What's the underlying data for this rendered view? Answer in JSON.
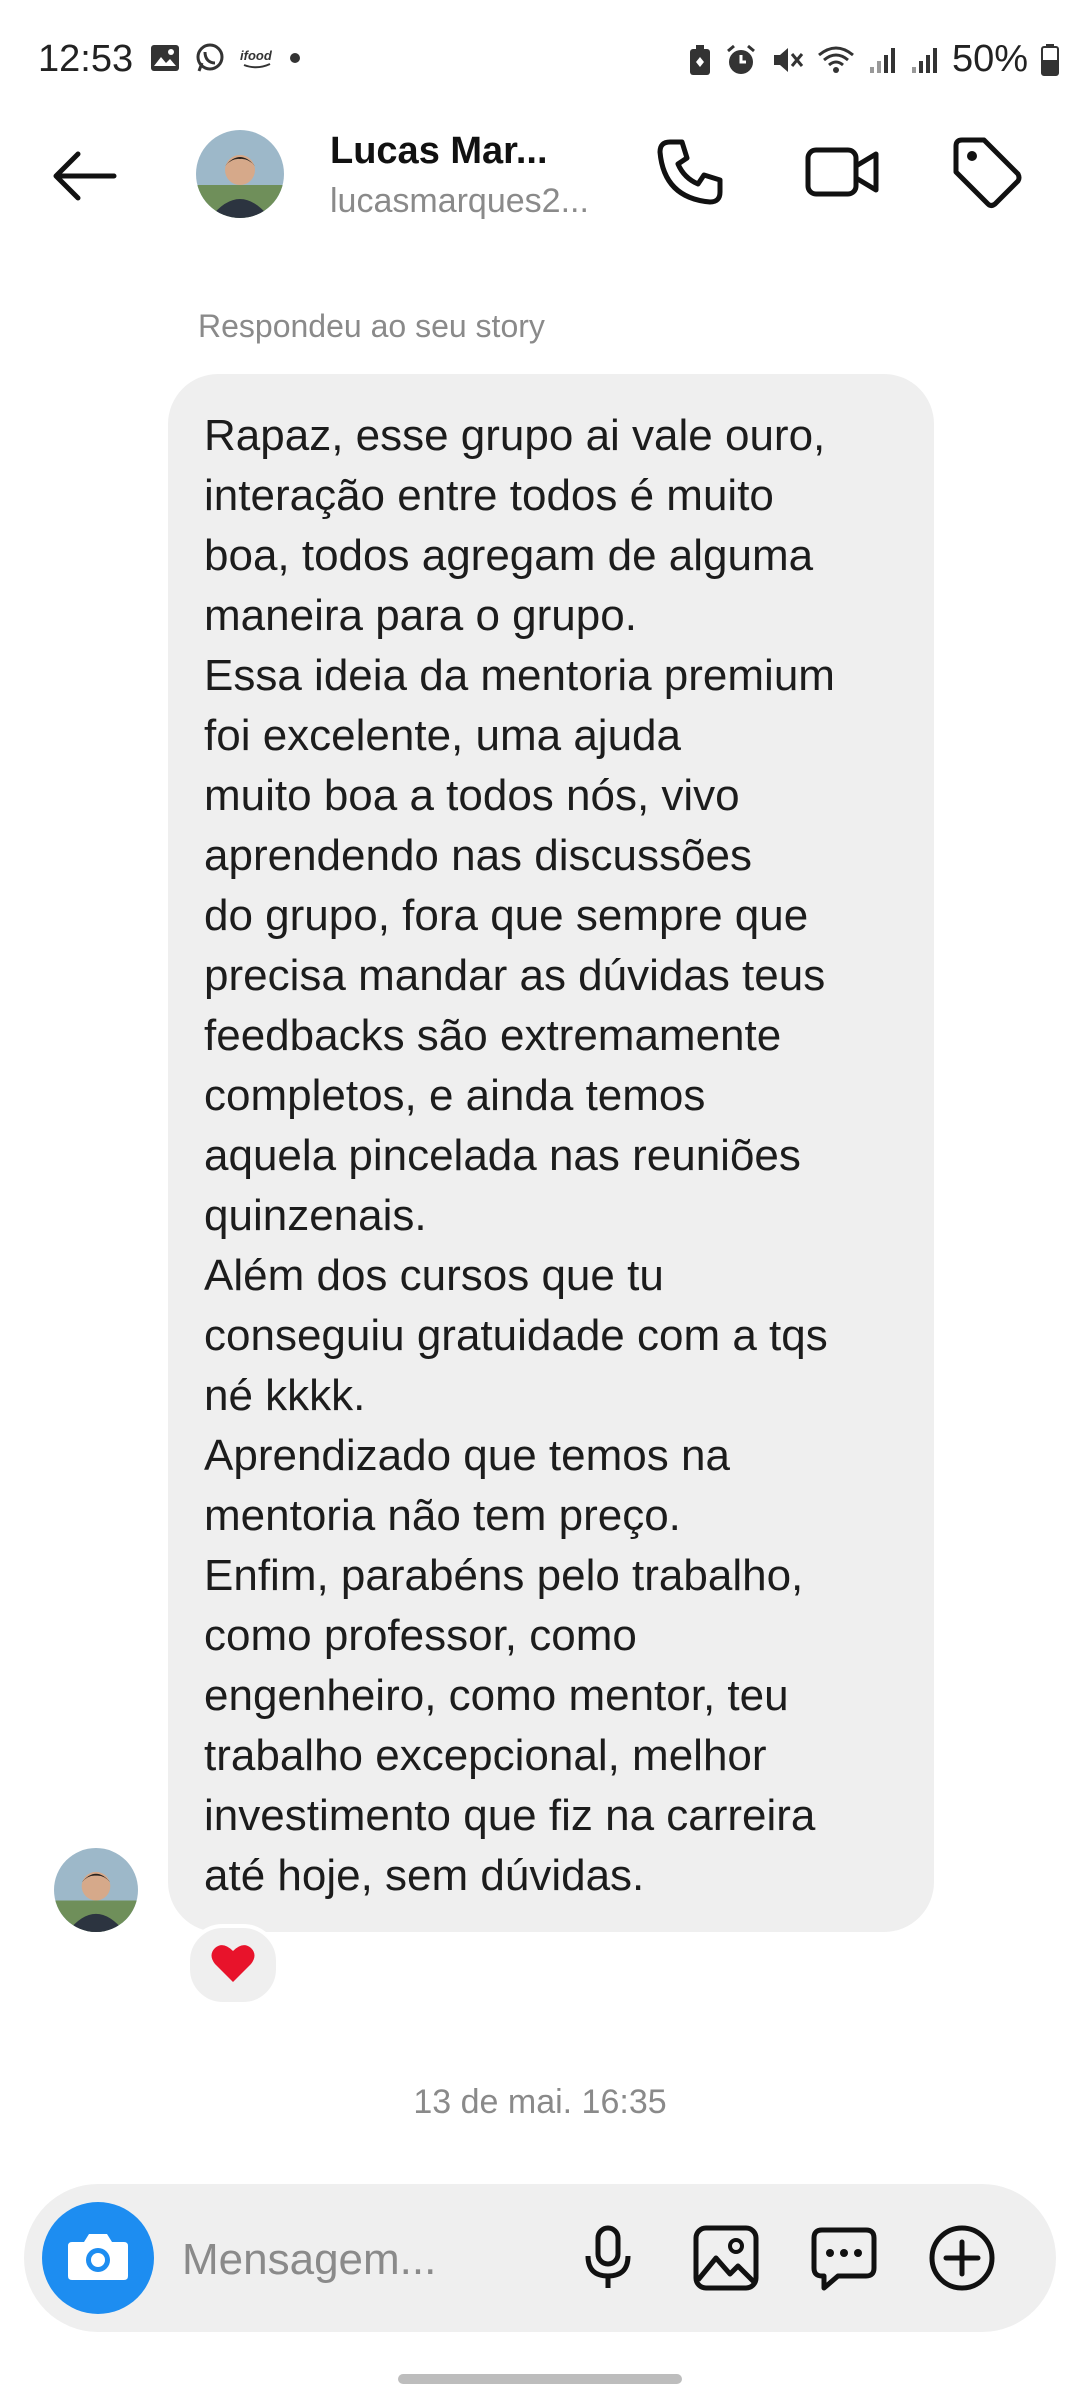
{
  "status_bar": {
    "time": "12:53",
    "battery": "50%",
    "left_icons": [
      "image-icon",
      "whatsapp-icon",
      "ifood-icon",
      "dot-icon"
    ],
    "right_icons": [
      "battery-saver-icon",
      "alarm-icon",
      "mute-icon",
      "wifi-icon",
      "signal-icon",
      "signal-icon",
      "battery-icon"
    ]
  },
  "header": {
    "name": "Lucas Mar...",
    "handle": "lucasmarques2...",
    "icons": [
      "back-arrow-icon",
      "phone-icon",
      "video-camera-icon",
      "tag-icon"
    ]
  },
  "conversation": {
    "reply_label": "Respondeu ao seu story",
    "message_lines": [
      "Rapaz, esse grupo ai vale ouro,",
      "interação entre todos é muito",
      "boa, todos agregam de alguma",
      "maneira para o grupo.",
      "Essa ideia da mentoria premium",
      "foi excelente, uma ajuda",
      "muito boa a todos nós, vivo",
      "aprendendo nas discussões",
      "do grupo, fora que sempre que",
      "precisa mandar as dúvidas teus",
      "feedbacks são extremamente",
      "completos, e ainda temos",
      "aquela pincelada nas reuniões",
      "quinzenais.",
      "Além dos cursos que tu",
      "conseguiu gratuidade com a tqs",
      "né kkkk.",
      "Aprendizado que temos na",
      "mentoria não tem preço.",
      "Enfim, parabéns pelo trabalho,",
      "como professor, como",
      "engenheiro, como mentor, teu",
      "trabalho excepcional, melhor",
      "investimento que fiz na carreira",
      "até hoje, sem dúvidas."
    ],
    "reaction": "heart-icon",
    "timestamp": "13 de mai. 16:35"
  },
  "composer": {
    "placeholder": "Mensagem...",
    "icons": [
      "camera-icon",
      "microphone-icon",
      "gallery-icon",
      "sticker-chat-icon",
      "add-circle-icon"
    ]
  },
  "colors": {
    "accent": "#1d8df1",
    "bubble": "#efefef",
    "heart": "#e8132b",
    "muted_text": "#8a8a8a"
  }
}
